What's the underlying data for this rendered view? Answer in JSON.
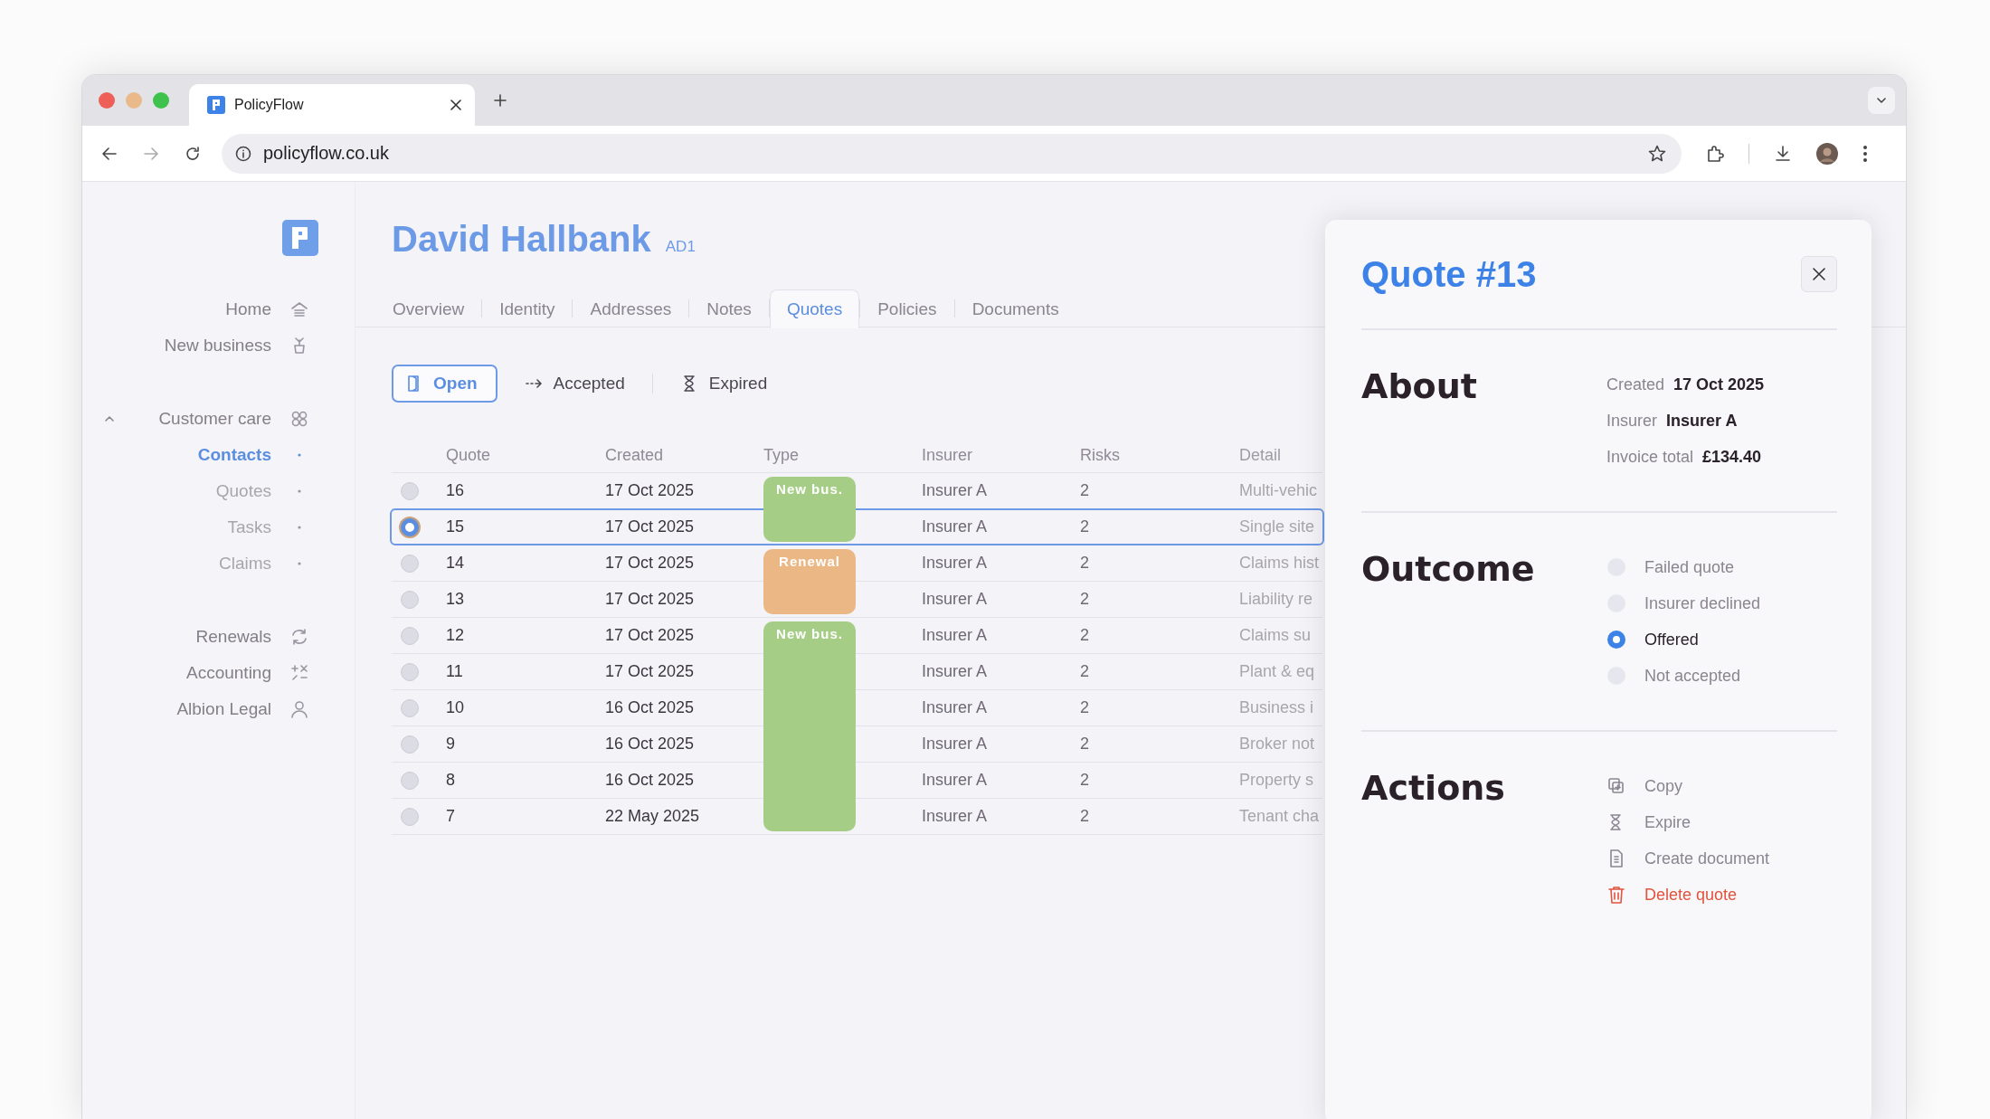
{
  "browser": {
    "tab_title": "PolicyFlow",
    "url": "policyflow.co.uk"
  },
  "sidebar": {
    "sections": [
      {
        "items": [
          {
            "label": "Home",
            "selected": false
          },
          {
            "label": "New business",
            "selected": false
          }
        ]
      },
      {
        "items": [
          {
            "label": "Customer care",
            "selected": false,
            "expanded": true,
            "children": [
              {
                "label": "Contacts",
                "selected": true
              },
              {
                "label": "Quotes",
                "selected": false
              },
              {
                "label": "Tasks",
                "selected": false
              },
              {
                "label": "Claims",
                "selected": false
              }
            ]
          }
        ]
      },
      {
        "items": [
          {
            "label": "Renewals",
            "selected": false
          },
          {
            "label": "Accounting",
            "selected": false
          },
          {
            "label": "Albion Legal",
            "selected": false
          }
        ]
      }
    ]
  },
  "contact": {
    "name": "David Hallbank",
    "code": "AD1"
  },
  "tabs": [
    {
      "label": "Overview",
      "selected": false
    },
    {
      "label": "Identity",
      "selected": false
    },
    {
      "label": "Addresses",
      "selected": false
    },
    {
      "label": "Notes",
      "selected": false
    },
    {
      "label": "Quotes",
      "selected": true
    },
    {
      "label": "Policies",
      "selected": false
    },
    {
      "label": "Documents",
      "selected": false
    }
  ],
  "filters": [
    {
      "label": "Open",
      "selected": true
    },
    {
      "label": "Accepted",
      "selected": false
    },
    {
      "label": "Expired",
      "selected": false
    }
  ],
  "table": {
    "columns": [
      "Quote",
      "Created",
      "Type",
      "Insurer",
      "Risks",
      "Detail"
    ],
    "groups": [
      {
        "type": "New bus.",
        "color": "#a6cd86",
        "rows": [
          {
            "quote": "16",
            "created": "17 Oct 2025",
            "insurer": "Insurer A",
            "risks": "2",
            "detail": "Multi-vehic",
            "selected": false
          },
          {
            "quote": "15",
            "created": "17 Oct 2025",
            "insurer": "Insurer A",
            "risks": "2",
            "detail": "Single site",
            "selected": true
          }
        ]
      },
      {
        "type": "Renewal",
        "color": "#ebb785",
        "rows": [
          {
            "quote": "14",
            "created": "17 Oct 2025",
            "insurer": "Insurer A",
            "risks": "2",
            "detail": "Claims hist",
            "selected": false
          },
          {
            "quote": "13",
            "created": "17 Oct 2025",
            "insurer": "Insurer A",
            "risks": "2",
            "detail": "Liability re",
            "selected": false
          }
        ]
      },
      {
        "type": "New bus.",
        "color": "#a6cd86",
        "rows": [
          {
            "quote": "12",
            "created": "17 Oct 2025",
            "insurer": "Insurer A",
            "risks": "2",
            "detail": "Claims su",
            "selected": false
          },
          {
            "quote": "11",
            "created": "17 Oct 2025",
            "insurer": "Insurer A",
            "risks": "2",
            "detail": "Plant & eq",
            "selected": false
          },
          {
            "quote": "10",
            "created": "16 Oct 2025",
            "insurer": "Insurer A",
            "risks": "2",
            "detail": "Business i",
            "selected": false
          },
          {
            "quote": "9",
            "created": "16 Oct 2025",
            "insurer": "Insurer A",
            "risks": "2",
            "detail": "Broker not",
            "selected": false
          },
          {
            "quote": "8",
            "created": "16 Oct 2025",
            "insurer": "Insurer A",
            "risks": "2",
            "detail": "Property s",
            "selected": false
          },
          {
            "quote": "7",
            "created": "22 May 2025",
            "insurer": "Insurer A",
            "risks": "2",
            "detail": "Tenant cha",
            "selected": false
          }
        ]
      }
    ]
  },
  "panel": {
    "title": "Quote #13",
    "about": {
      "heading": "About",
      "fields": [
        {
          "label": "Created",
          "value": "17 Oct 2025"
        },
        {
          "label": "Insurer",
          "value": "Insurer A"
        },
        {
          "label": "Invoice total",
          "value": "£134.40"
        }
      ]
    },
    "outcome": {
      "heading": "Outcome",
      "options": [
        {
          "label": "Failed quote",
          "selected": false
        },
        {
          "label": "Insurer declined",
          "selected": false
        },
        {
          "label": "Offered",
          "selected": true
        },
        {
          "label": "Not accepted",
          "selected": false
        }
      ]
    },
    "actions": {
      "heading": "Actions",
      "items": [
        {
          "label": "Copy",
          "kind": "normal"
        },
        {
          "label": "Expire",
          "kind": "normal"
        },
        {
          "label": "Create document",
          "kind": "normal"
        },
        {
          "label": "Delete quote",
          "kind": "danger"
        }
      ]
    }
  }
}
